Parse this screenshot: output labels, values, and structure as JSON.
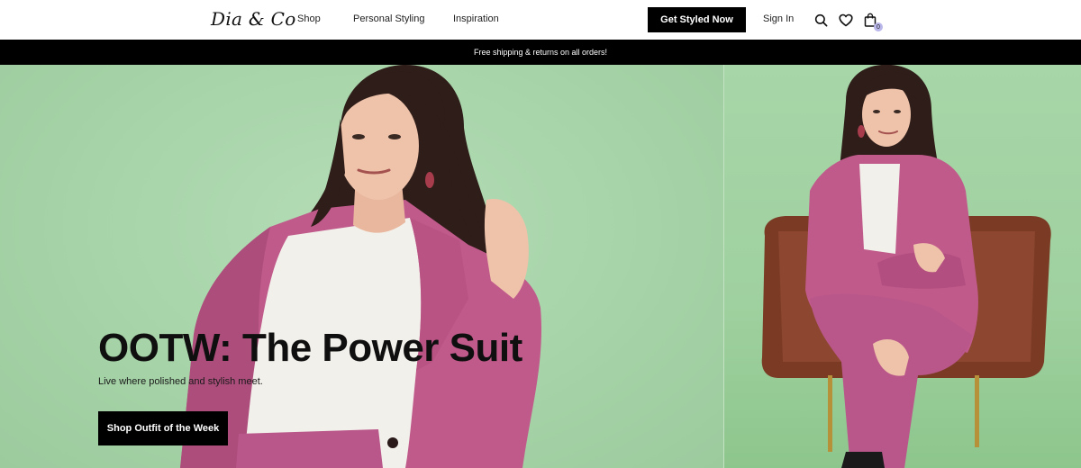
{
  "header": {
    "logo": "Dia & Co",
    "nav": {
      "shop": "Shop",
      "personal_styling": "Personal Styling",
      "inspiration": "Inspiration"
    },
    "cta_label": "Get Styled Now",
    "signin_label": "Sign In",
    "icons": [
      "search-icon",
      "heart-icon",
      "shopping-bag-icon"
    ],
    "bag_count": "0"
  },
  "announcement": "Free shipping & returns on all orders!",
  "hero": {
    "title": "OOTW: The Power Suit",
    "subtitle": "Live where polished and stylish meet.",
    "button_label": "Shop Outfit of the Week"
  },
  "colors": {
    "brand_black": "#000000",
    "hero_green": "#a8d6a9",
    "suit_pink": "#c05a8b",
    "bag_badge": "#b9b6ea"
  }
}
